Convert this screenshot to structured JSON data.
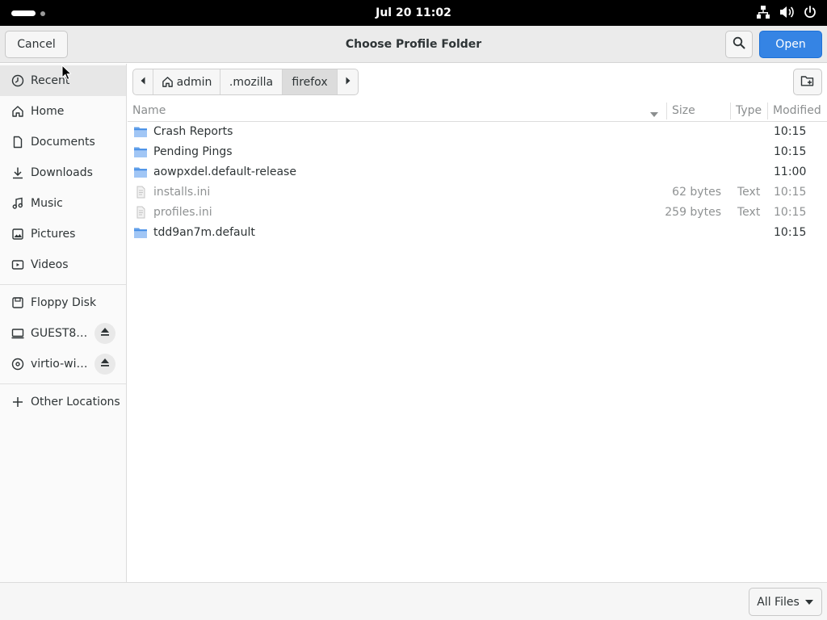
{
  "topbar": {
    "clock": "Jul 20  11:02",
    "tray_icons": [
      "network-icon",
      "volume-icon",
      "power-icon"
    ]
  },
  "dialog": {
    "title": "Choose Profile Folder",
    "cancel_label": "Cancel",
    "open_label": "Open",
    "accent_color": "#3584e4"
  },
  "sidebar": {
    "places": [
      {
        "label": "Recent",
        "icon": "clock-icon"
      },
      {
        "label": "Home",
        "icon": "home-icon"
      },
      {
        "label": "Documents",
        "icon": "document-icon"
      },
      {
        "label": "Downloads",
        "icon": "download-icon"
      },
      {
        "label": "Music",
        "icon": "music-icon"
      },
      {
        "label": "Pictures",
        "icon": "picture-icon"
      },
      {
        "label": "Videos",
        "icon": "video-icon"
      }
    ],
    "devices": [
      {
        "label": "Floppy Disk",
        "icon": "floppy-icon"
      },
      {
        "label": "GUEST8…",
        "icon": "drive-icon"
      },
      {
        "label": "virtio-wi…",
        "icon": "disc-icon"
      }
    ],
    "other": {
      "label": "Other Locations",
      "icon": "plus-icon"
    }
  },
  "pathbar": {
    "crumbs": [
      "admin",
      ".mozilla",
      "firefox"
    ],
    "active": "firefox"
  },
  "columns": {
    "name": "Name",
    "size": "Size",
    "type": "Type",
    "modified": "Modified"
  },
  "files": [
    {
      "name": "Crash Reports",
      "size": "",
      "type": "",
      "modified": "10:15",
      "kind": "folder"
    },
    {
      "name": "Pending Pings",
      "size": "",
      "type": "",
      "modified": "10:15",
      "kind": "folder"
    },
    {
      "name": "aowpxdel.default-release",
      "size": "",
      "type": "",
      "modified": "11:00",
      "kind": "folder"
    },
    {
      "name": "installs.ini",
      "size": "62 bytes",
      "type": "Text",
      "modified": "10:15",
      "kind": "file"
    },
    {
      "name": "profiles.ini",
      "size": "259 bytes",
      "type": "Text",
      "modified": "10:15",
      "kind": "file"
    },
    {
      "name": "tdd9an7m.default",
      "size": "",
      "type": "",
      "modified": "10:15",
      "kind": "folder"
    }
  ],
  "filter": {
    "selected": "All Files"
  }
}
